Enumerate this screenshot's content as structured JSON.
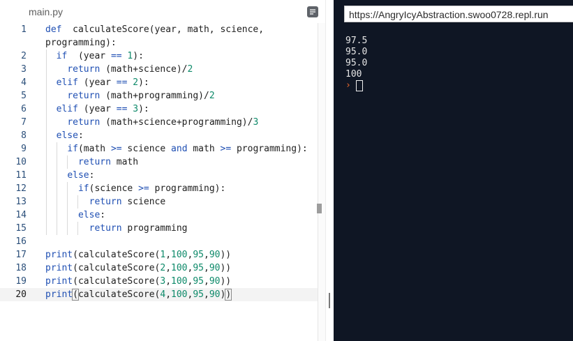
{
  "editor": {
    "tab_title": "main.py",
    "menu_icon": "sidebar-menu-icon",
    "code": [
      {
        "n": "1",
        "t": [
          [
            "kw",
            "def"
          ],
          [
            "",
            "  calculateScore(year, math, science,"
          ]
        ]
      },
      {
        "n": "",
        "t": [
          [
            "",
            "programming):"
          ]
        ]
      },
      {
        "n": "2",
        "t": [
          [
            "",
            "  "
          ],
          [
            "kw",
            "if"
          ],
          [
            "",
            ""
          ],
          [
            "",
            "  (year "
          ],
          [
            "kw",
            "=="
          ],
          [
            "",
            " "
          ],
          [
            "num",
            "1"
          ],
          [
            "",
            "):"
          ]
        ]
      },
      {
        "n": "3",
        "t": [
          [
            "",
            "    "
          ],
          [
            "kw",
            "return"
          ],
          [
            "",
            " (math+science)/"
          ],
          [
            "num",
            "2"
          ]
        ]
      },
      {
        "n": "4",
        "t": [
          [
            "",
            "  "
          ],
          [
            "kw",
            "elif"
          ],
          [
            "",
            " (year "
          ],
          [
            "kw",
            "=="
          ],
          [
            "",
            " "
          ],
          [
            "num",
            "2"
          ],
          [
            "",
            "):"
          ]
        ]
      },
      {
        "n": "5",
        "t": [
          [
            "",
            "    "
          ],
          [
            "kw",
            "return"
          ],
          [
            "",
            " (math+programming)/"
          ],
          [
            "num",
            "2"
          ]
        ]
      },
      {
        "n": "6",
        "t": [
          [
            "",
            "  "
          ],
          [
            "kw",
            "elif"
          ],
          [
            "",
            " (year "
          ],
          [
            "kw",
            "=="
          ],
          [
            "",
            " "
          ],
          [
            "num",
            "3"
          ],
          [
            "",
            "):"
          ]
        ]
      },
      {
        "n": "7",
        "t": [
          [
            "",
            "    "
          ],
          [
            "kw",
            "return"
          ],
          [
            "",
            " (math+science+programming)/"
          ],
          [
            "num",
            "3"
          ]
        ]
      },
      {
        "n": "8",
        "t": [
          [
            "",
            "  "
          ],
          [
            "kw",
            "else"
          ],
          [
            "",
            ":"
          ]
        ]
      },
      {
        "n": "9",
        "t": [
          [
            "",
            "    "
          ],
          [
            "kw",
            "if"
          ],
          [
            "",
            "(math "
          ],
          [
            "kw",
            ">="
          ],
          [
            "",
            " science "
          ],
          [
            "kw",
            "and"
          ],
          [
            "",
            " math "
          ],
          [
            "kw",
            ">="
          ],
          [
            "",
            " programming):"
          ]
        ]
      },
      {
        "n": "10",
        "t": [
          [
            "",
            "      "
          ],
          [
            "kw",
            "return"
          ],
          [
            "",
            " math"
          ]
        ]
      },
      {
        "n": "11",
        "t": [
          [
            "",
            "    "
          ],
          [
            "kw",
            "else"
          ],
          [
            "",
            ":"
          ]
        ]
      },
      {
        "n": "12",
        "t": [
          [
            "",
            "      "
          ],
          [
            "kw",
            "if"
          ],
          [
            "",
            "(science "
          ],
          [
            "kw",
            ">="
          ],
          [
            "",
            " programming):"
          ]
        ]
      },
      {
        "n": "13",
        "t": [
          [
            "",
            "        "
          ],
          [
            "kw",
            "return"
          ],
          [
            "",
            " science"
          ]
        ]
      },
      {
        "n": "14",
        "t": [
          [
            "",
            "      "
          ],
          [
            "kw",
            "else"
          ],
          [
            "",
            ":"
          ]
        ]
      },
      {
        "n": "15",
        "t": [
          [
            "",
            "        "
          ],
          [
            "kw",
            "return"
          ],
          [
            "",
            " programming"
          ]
        ]
      },
      {
        "n": "16",
        "t": []
      },
      {
        "n": "17",
        "t": [
          [
            "kw",
            "print"
          ],
          [
            "",
            "(calculateScore("
          ],
          [
            "num",
            "1"
          ],
          [
            "",
            ","
          ],
          [
            "num",
            "100"
          ],
          [
            "",
            ","
          ],
          [
            "num",
            "95"
          ],
          [
            "",
            ","
          ],
          [
            "num",
            "90"
          ],
          [
            "",
            "))"
          ]
        ]
      },
      {
        "n": "18",
        "t": [
          [
            "kw",
            "print"
          ],
          [
            "",
            "(calculateScore("
          ],
          [
            "num",
            "2"
          ],
          [
            "",
            ","
          ],
          [
            "num",
            "100"
          ],
          [
            "",
            ","
          ],
          [
            "num",
            "95"
          ],
          [
            "",
            ","
          ],
          [
            "num",
            "90"
          ],
          [
            "",
            "))"
          ]
        ]
      },
      {
        "n": "19",
        "t": [
          [
            "kw",
            "print"
          ],
          [
            "",
            "(calculateScore("
          ],
          [
            "num",
            "3"
          ],
          [
            "",
            ","
          ],
          [
            "num",
            "100"
          ],
          [
            "",
            ","
          ],
          [
            "num",
            "95"
          ],
          [
            "",
            ","
          ],
          [
            "num",
            "90"
          ],
          [
            "",
            "))"
          ]
        ]
      },
      {
        "n": "20",
        "t": [
          [
            "kw",
            "print"
          ],
          [
            "bh",
            "("
          ],
          [
            "",
            "calculateScore("
          ],
          [
            "num",
            "4"
          ],
          [
            "",
            ","
          ],
          [
            "num",
            "100"
          ],
          [
            "",
            ","
          ],
          [
            "num",
            "95"
          ],
          [
            "",
            ","
          ],
          [
            "num",
            "90"
          ],
          [
            "",
            ")"
          ],
          [
            "bh",
            ")"
          ]
        ]
      }
    ]
  },
  "console": {
    "url": "https://AngryIcyAbstraction.swoo0728.repl.run",
    "output": [
      "97.5",
      "95.0",
      "95.0",
      "100"
    ],
    "prompt_icon": "chevron-right-icon"
  },
  "colors": {
    "keyword": "#1f4fb3",
    "number": "#0e8a6a",
    "console_bg": "#0f1624",
    "prompt": "#f26b2c"
  }
}
